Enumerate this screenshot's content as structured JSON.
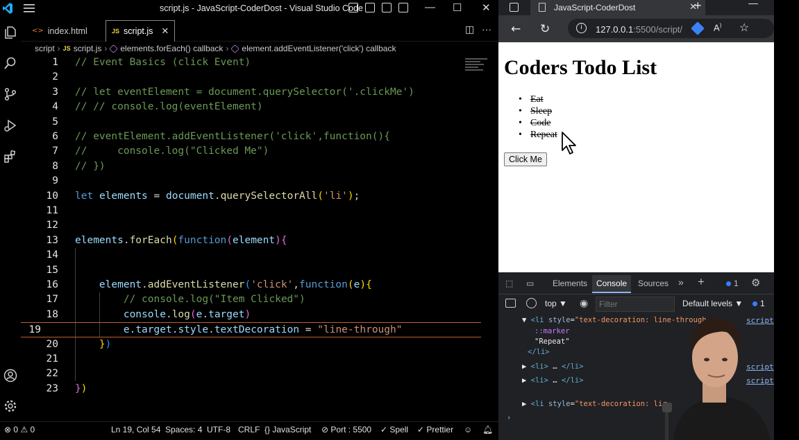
{
  "vscode": {
    "title": "script.js - JavaScript-CoderDost - Visual Studio Code",
    "tabs": [
      {
        "label": "index.html",
        "icon": "html-file-icon"
      },
      {
        "label": "script.js",
        "icon": "js-file-icon",
        "icon_text": "JS",
        "close": "✕"
      }
    ],
    "breadcrumb": [
      "script",
      "script.js",
      "elements.forEach() callback",
      "element.addEventListener('click') callback"
    ],
    "line_numbers": [
      "1",
      "2",
      "3",
      "4",
      "5",
      "6",
      "7",
      "8",
      "9",
      "10",
      "11",
      "12",
      "13",
      "14",
      "15",
      "16",
      "17",
      "18",
      "19",
      "20",
      "21",
      "22",
      "23"
    ],
    "current_line": 19,
    "status": {
      "errors": "0",
      "warnings": "0",
      "position": "Ln 19, Col 54",
      "spaces": "Spaces: 4",
      "encoding": "UTF-8",
      "eol": "CRLF",
      "language": "JavaScript",
      "port": "Port : 5500",
      "spell": "Spell",
      "prettier": "Prettier"
    }
  },
  "browser": {
    "tab_title": "JavaScript-CoderDost",
    "url_host": "127.0.0.1",
    "url_rest": ":5500/script/",
    "page": {
      "heading": "Coders Todo List",
      "items": [
        "Eat",
        "Sleep",
        "Code",
        "Repeat"
      ],
      "button": "Click Me"
    },
    "devtools": {
      "tabs": [
        "Elements",
        "Console",
        "Sources"
      ],
      "active_tab": "Console",
      "issues_count": "1",
      "context": "top",
      "filter_placeholder": "Filter",
      "levels": "Default levels",
      "levels_count": "1",
      "console_lines": {
        "l1_tag_open": "<li",
        "l1_attr": "style",
        "l1_val": "\"text-decoration: line-through",
        "l2": "::marker",
        "l3": "\"Repeat\"",
        "l4": "</li>",
        "l5": "<li>",
        "l5b": "…",
        "l5c": "</li>",
        "l6": "<li>",
        "l6b": "…",
        "l6c": "</li>",
        "l7_tag_open": "<li",
        "l7_attr": "style",
        "l7_val": "\"text-decoration: lir",
        "src": "script"
      }
    }
  }
}
